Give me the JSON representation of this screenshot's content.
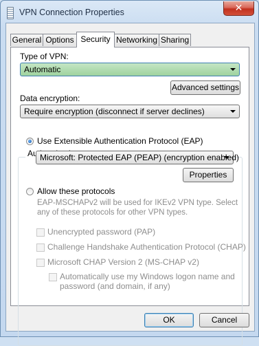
{
  "window": {
    "title": "VPN Connection Properties",
    "close_glyph": "✕"
  },
  "tabs": [
    {
      "label": "General"
    },
    {
      "label": "Options"
    },
    {
      "label": "Security",
      "active": true
    },
    {
      "label": "Networking"
    },
    {
      "label": "Sharing"
    }
  ],
  "security": {
    "vpn_type_label": "Type of VPN:",
    "vpn_type_value": "Automatic",
    "advanced_button": "Advanced settings",
    "encryption_label": "Data encryption:",
    "encryption_value": "Require encryption (disconnect if server declines)",
    "auth_group_label": "Authentication",
    "eap_radio_label": "Use Extensible Authentication Protocol (EAP)",
    "eap_radio_checked": true,
    "eap_method_value": "Microsoft: Protected EAP (PEAP) (encryption enabled)",
    "properties_button": "Properties",
    "allow_radio_label": "Allow these protocols",
    "allow_radio_checked": false,
    "ikev2_note_line1": "EAP-MSCHAPv2 will be used for IKEv2 VPN type. Select",
    "ikev2_note_line2": "any of these protocols for other VPN types.",
    "protocols": [
      {
        "label": "Unencrypted password (PAP)",
        "checked": false
      },
      {
        "label": "Challenge Handshake Authentication Protocol (CHAP)",
        "checked": false
      },
      {
        "label": "Microsoft CHAP Version 2 (MS-CHAP v2)",
        "checked": false
      }
    ],
    "auto_logon_line1": "Automatically use my Windows logon name and",
    "auto_logon_line2": "password (and domain, if any)"
  },
  "footer": {
    "ok_button": "OK",
    "cancel_button": "Cancel"
  },
  "colors": {
    "combo_green": "#9fd29f",
    "close_red": "#c2311f",
    "disabled_text": "#8d8d8d"
  }
}
